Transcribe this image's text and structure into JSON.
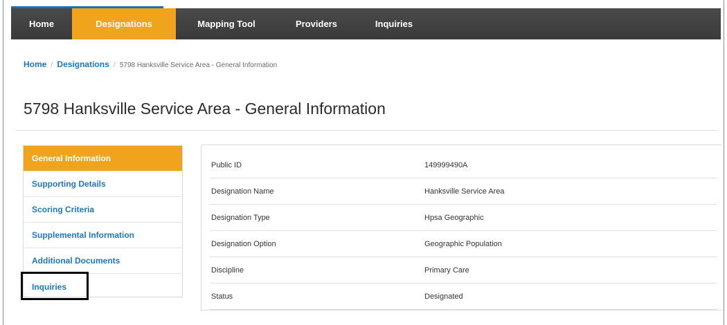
{
  "nav": {
    "items": [
      {
        "label": "Home"
      },
      {
        "label": "Designations"
      },
      {
        "label": "Mapping Tool"
      },
      {
        "label": "Providers"
      },
      {
        "label": "Inquiries"
      }
    ],
    "active_index": 1
  },
  "breadcrumb": {
    "home": "Home",
    "designations": "Designations",
    "current": "5798 Hanksville Service Area - General Information"
  },
  "page": {
    "title": "5798 Hanksville Service Area - General Information"
  },
  "sidebar": {
    "items": [
      {
        "label": "General Information"
      },
      {
        "label": "Supporting Details"
      },
      {
        "label": "Scoring Criteria"
      },
      {
        "label": "Supplemental Information"
      },
      {
        "label": "Additional Documents"
      },
      {
        "label": "Inquiries"
      }
    ],
    "active_index": 0,
    "highlighted_index": 5
  },
  "info": {
    "rows": [
      {
        "label": "Public ID",
        "value": "149999490A"
      },
      {
        "label": "Designation Name",
        "value": "Hanksville Service Area"
      },
      {
        "label": "Designation Type",
        "value": "Hpsa Geographic"
      },
      {
        "label": "Designation Option",
        "value": "Geographic Population"
      },
      {
        "label": "Discipline",
        "value": "Primary Care"
      },
      {
        "label": "Status",
        "value": "Designated"
      }
    ]
  },
  "colors": {
    "nav_background": "#3f3f3f",
    "accent_orange": "#f0a41e",
    "link_blue": "#1f77c0",
    "highlight_border": "#000000"
  }
}
